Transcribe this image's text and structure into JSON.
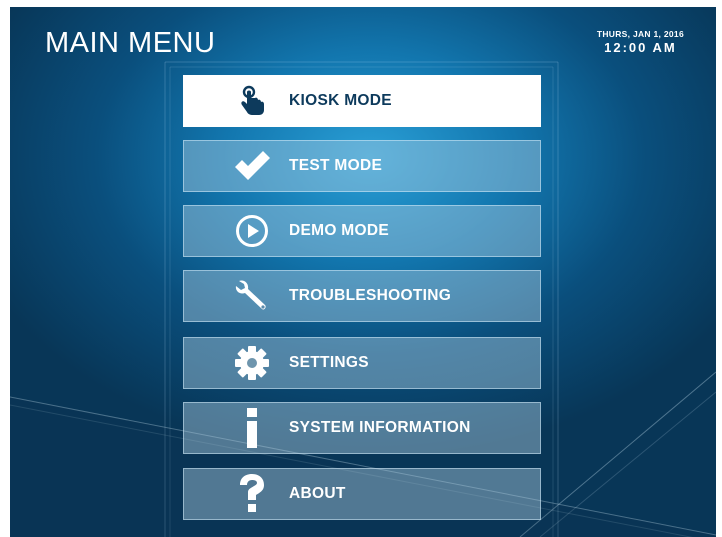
{
  "header": {
    "title": "MAIN MENU",
    "date": "THURS, JAN 1, 2016",
    "time": "12:00 AM"
  },
  "menu": {
    "items": [
      {
        "label": "KIOSK MODE",
        "icon": "touch-icon",
        "active": true
      },
      {
        "label": "TEST MODE",
        "icon": "checkmark-icon",
        "active": false
      },
      {
        "label": "DEMO MODE",
        "icon": "play-icon",
        "active": false
      },
      {
        "label": "TROUBLESHOOTING",
        "icon": "wrench-icon",
        "active": false
      },
      {
        "label": "SETTINGS",
        "icon": "gear-icon",
        "active": false
      },
      {
        "label": "SYSTEM INFORMATION",
        "icon": "info-icon",
        "active": false
      },
      {
        "label": "ABOUT",
        "icon": "question-icon",
        "active": false
      }
    ]
  },
  "colors": {
    "background": "#0a4f7d",
    "accent": "#1276ae",
    "active_text": "#0d3a5c",
    "text": "#ffffff"
  }
}
